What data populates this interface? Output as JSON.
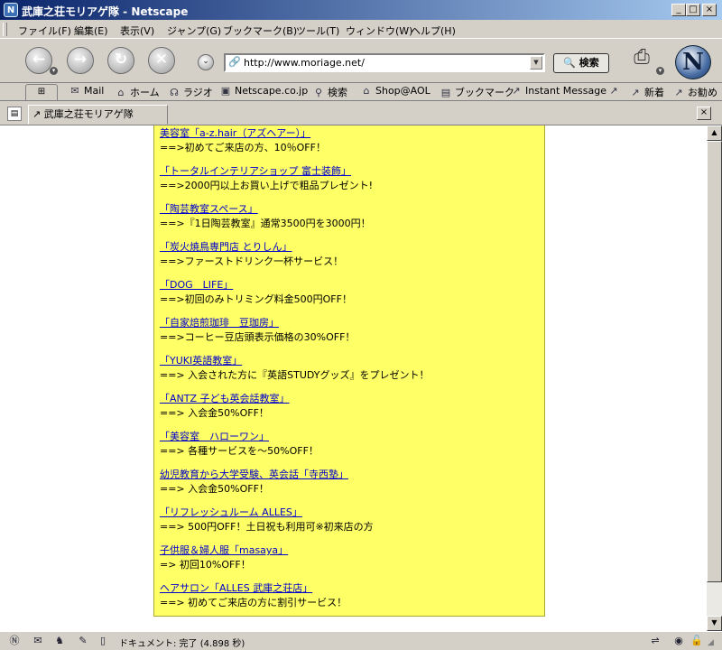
{
  "window": {
    "title": "武庫之荘モリアゲ隊 - Netscape",
    "app_icon": "netscape-n-icon",
    "minimize": "_",
    "maximize": "□",
    "close": "×"
  },
  "menu": [
    "ファイル(F)",
    "編集(E)",
    "表示(V)",
    "ジャンプ(G)",
    "ブックマーク(B)",
    "ツール(T)",
    "ウィンドウ(W)",
    "ヘルプ(H)"
  ],
  "nav": {
    "url": "http://www.moriage.net/",
    "search_label": "検索",
    "icons": [
      "back-arrow-icon",
      "forward-arrow-icon",
      "reload-icon",
      "stop-icon"
    ]
  },
  "personal_toolbar": {
    "items": [
      {
        "icon": "mail-icon",
        "label": "Mail"
      },
      {
        "icon": "home-icon",
        "label": "ホーム"
      },
      {
        "icon": "radio-icon",
        "label": "ラジオ"
      },
      {
        "icon": "netscape-my-icon",
        "label": "Netscape.co.jp"
      },
      {
        "icon": "search-icon",
        "label": "検索"
      },
      {
        "icon": "aol-house-icon",
        "label": "Shop@AOL"
      },
      {
        "icon": "bookmark-folder-icon",
        "label": "ブックマーク"
      },
      {
        "icon": "link-icon",
        "label": "Instant Message"
      },
      {
        "icon": "link-icon",
        "label": ""
      },
      {
        "icon": "link-icon",
        "label": "新着"
      },
      {
        "icon": "link-icon",
        "label": "お勧め"
      }
    ]
  },
  "tab": {
    "label": "武庫之荘モリアゲ隊",
    "close": "×"
  },
  "entries": [
    {
      "link": "美容室「a-z.hair（アズヘアー）」",
      "desc": "==>初めてご来店の方、10％OFF！"
    },
    {
      "link": "「トータルインテリアショップ 富士装飾」",
      "desc": "==>2000円以上お買い上げで粗品プレゼント!"
    },
    {
      "link": "「陶芸教室スペース」",
      "desc": "==>『1日陶芸教室』通常3500円を3000円！"
    },
    {
      "link": "「炭火焼鳥専門店 とりしん」",
      "desc": "==>ファーストドリンク一杯サービス！"
    },
    {
      "link": "「DOG　LIFE」",
      "desc": "==>初回のみトリミング料金500円OFF！"
    },
    {
      "link": "「自家焙煎珈琲　豆珈房」",
      "desc": "==>コーヒー豆店頭表示価格の30%OFF！"
    },
    {
      "link": "「YUKI英語教室」",
      "desc": "==> 入会された方に『英語STUDYグッズ』をプレゼント！"
    },
    {
      "link": "「ANTZ 子ども英会話教室」",
      "desc": "==> 入会金50%OFF！"
    },
    {
      "link": "「美容室　ハローワン」",
      "desc": "==> 各種サービスを～50%OFF！"
    },
    {
      "link": "幼児教育から大学受験、英会話「寺西塾」",
      "desc": "==> 入会金50%OFF！"
    },
    {
      "link": "「リフレッシュルーム ALLES」",
      "desc": "==> 500円OFF！土日祝も利用可※初来店の方"
    },
    {
      "link": "子供服＆婦人服「masaya」",
      "desc": "=> 初回10%OFF！"
    },
    {
      "link": "ヘアサロン「ALLES 武庫之荘店」",
      "desc": "==> 初めてご来店の方に割引サービス！"
    }
  ],
  "status": {
    "text": "ドキュメント: 完了 (4.898 秒)"
  },
  "colors": {
    "panel": "#ffff66",
    "link": "#0000cc",
    "chrome": "#d4d0c8",
    "titlebar_start": "#0a246a"
  }
}
